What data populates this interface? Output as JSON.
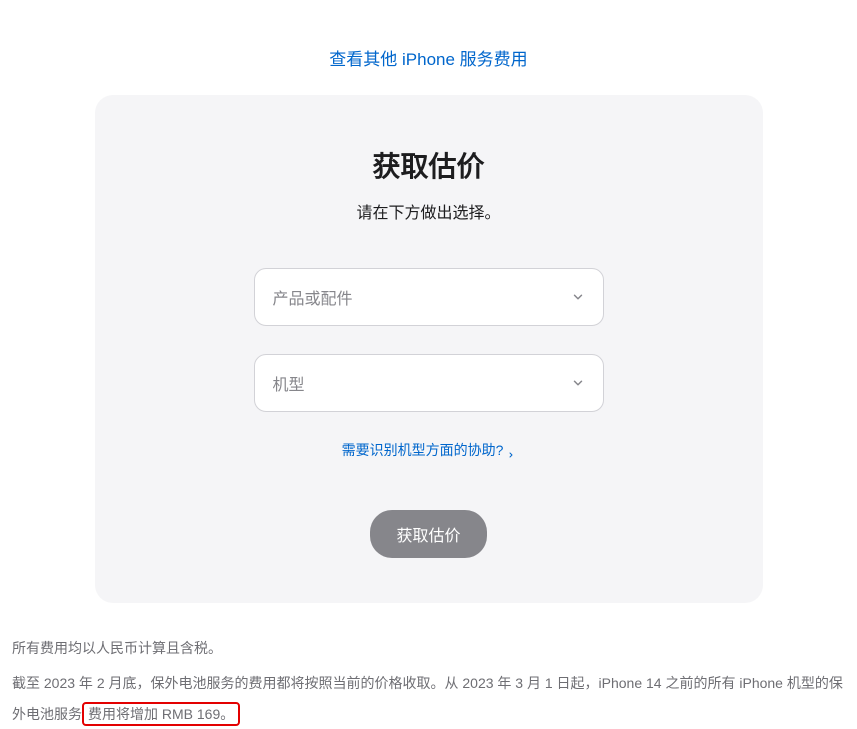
{
  "topLink": "查看其他 iPhone 服务费用",
  "card": {
    "title": "获取估价",
    "subtitle": "请在下方做出选择。",
    "select1": {
      "placeholder": "产品或配件"
    },
    "select2": {
      "placeholder": "机型"
    },
    "helpLink": "需要识别机型方面的协助?",
    "submitButton": "获取估价"
  },
  "footer": {
    "line1": "所有费用均以人民币计算且含税。",
    "line2_part1": "截至 2023 年 2 月底，保外电池服务的费用都将按照当前的价格收取。从 2023 年 3 月 1 日起，iPhone 14 之前的所有 iPhone 机型的保外电池服务",
    "line2_highlight": "费用将增加 RMB 169。"
  }
}
